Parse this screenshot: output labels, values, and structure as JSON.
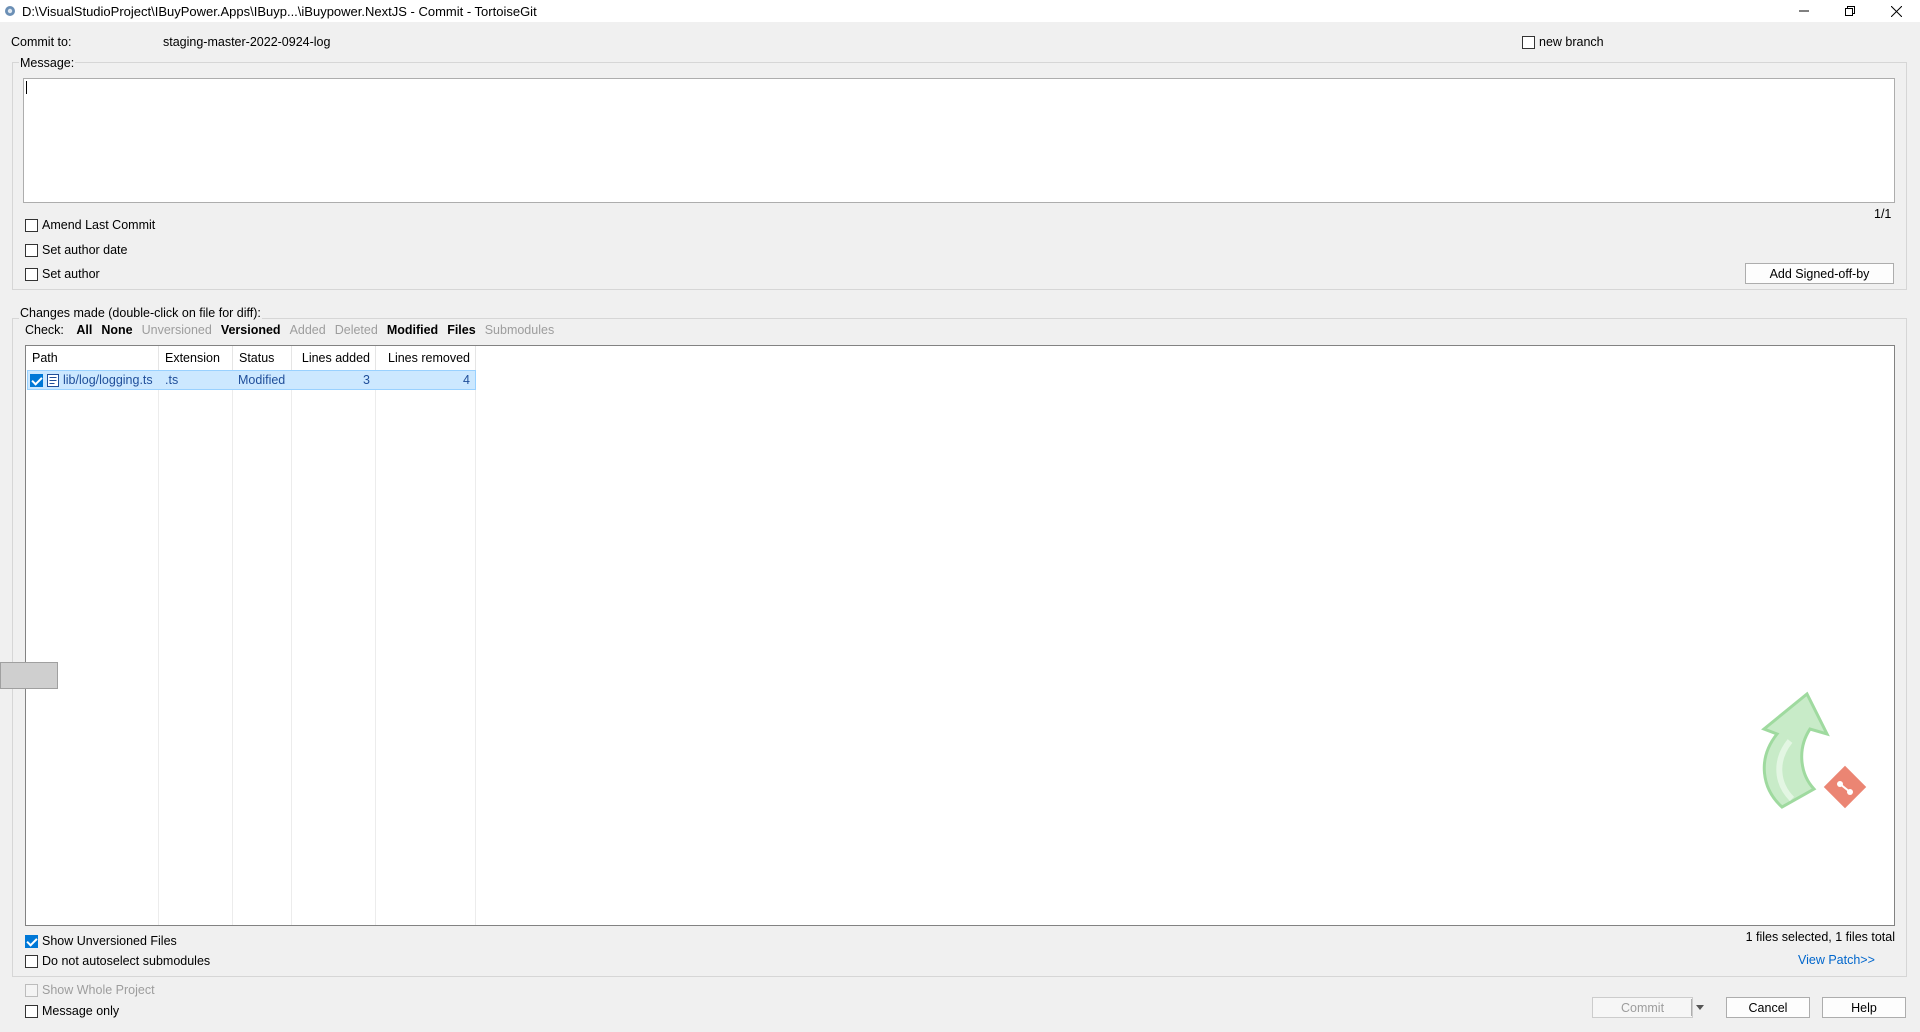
{
  "window": {
    "title": "D:\\VisualStudioProject\\IBuyPower.Apps\\IBuyp...\\iBuypower.NextJS - Commit - TortoiseGit"
  },
  "commit_to": {
    "label": "Commit to:",
    "branch": "staging-master-2022-0924-log",
    "new_branch_label": "new branch"
  },
  "message": {
    "label": "Message:",
    "value": "",
    "counter": "1/1"
  },
  "options": {
    "amend": "Amend Last Commit",
    "set_author_date": "Set author date",
    "set_author": "Set author",
    "signed_off_button": "Add Signed-off-by"
  },
  "changes": {
    "label": "Changes made (double-click on file for diff):",
    "check_label": "Check:",
    "filters": {
      "all": "All",
      "none": "None",
      "unversioned": "Unversioned",
      "versioned": "Versioned",
      "added": "Added",
      "deleted": "Deleted",
      "modified": "Modified",
      "files": "Files",
      "submodules": "Submodules"
    },
    "columns": {
      "path": "Path",
      "extension": "Extension",
      "status": "Status",
      "lines_added": "Lines added",
      "lines_removed": "Lines removed"
    },
    "rows": [
      {
        "path": "lib/log/logging.ts",
        "extension": ".ts",
        "status": "Modified",
        "lines_added": "3",
        "lines_removed": "4",
        "checked": true
      }
    ],
    "summary": "1 files selected, 1 files total",
    "view_patch": "View Patch>>"
  },
  "bottom": {
    "show_unversioned": "Show Unversioned Files",
    "no_autoselect": "Do not autoselect submodules",
    "show_whole_project": "Show Whole Project",
    "message_only": "Message only"
  },
  "buttons": {
    "commit": "Commit",
    "cancel": "Cancel",
    "help": "Help"
  },
  "colors": {
    "accent": "#0078d7",
    "selection": "#cce8ff",
    "logo_green": "#8fd48f",
    "logo_red": "#e8705a"
  }
}
